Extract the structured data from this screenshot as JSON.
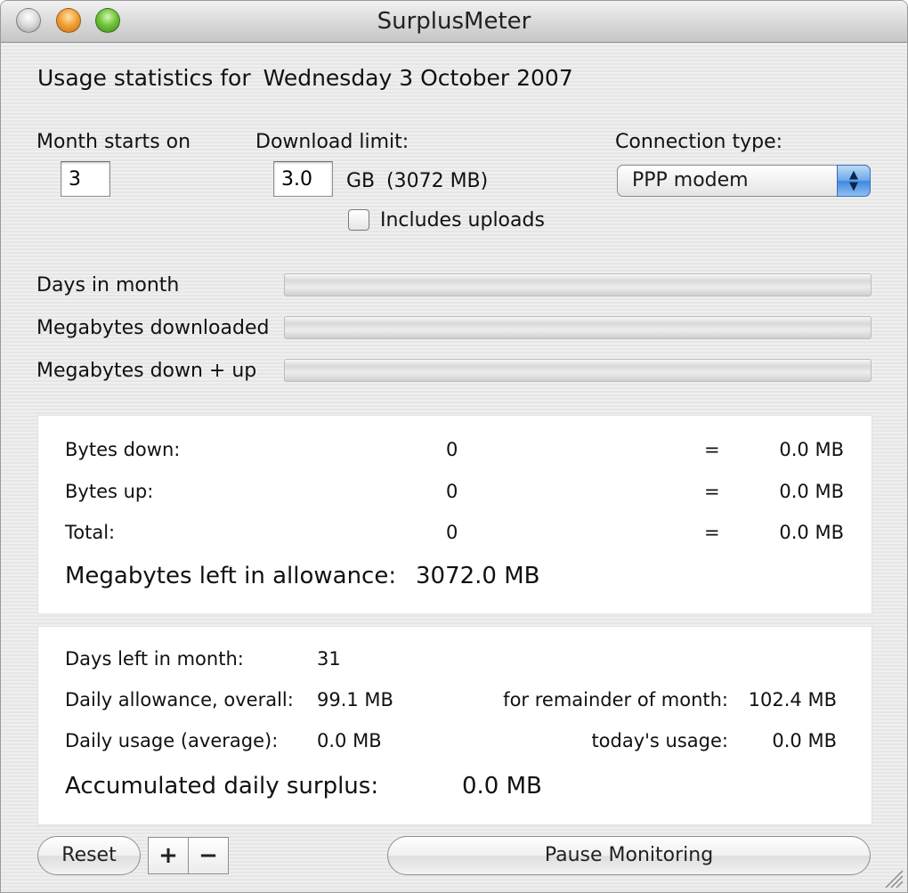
{
  "window": {
    "title": "SurplusMeter"
  },
  "header": {
    "usage_title": "Usage statistics for",
    "date": "Wednesday 3 October 2007"
  },
  "settings": {
    "month_starts_label": "Month starts on",
    "month_start_value": "3",
    "download_limit_label": "Download limit:",
    "download_limit_value": "3.0",
    "download_limit_unit": "GB",
    "download_limit_mb": "(3072 MB)",
    "includes_uploads_label": "Includes uploads",
    "includes_uploads_checked": false,
    "connection_type_label": "Connection type:",
    "connection_type_value": "PPP modem"
  },
  "meters": [
    {
      "label": "Days in month",
      "fraction": 0
    },
    {
      "label": "Megabytes downloaded",
      "fraction": 0
    },
    {
      "label": "Megabytes down + up",
      "fraction": 0
    }
  ],
  "bytes": {
    "rows": [
      {
        "label": "Bytes down:",
        "count": "0",
        "eq": "=",
        "mb": "0.0 MB"
      },
      {
        "label": "Bytes up:",
        "count": "0",
        "eq": "=",
        "mb": "0.0 MB"
      },
      {
        "label": "Total:",
        "count": "0",
        "eq": "=",
        "mb": "0.0 MB"
      }
    ],
    "left_label": "Megabytes left in allowance:",
    "left_value": "3072.0 MB"
  },
  "daily": {
    "days_left_label": "Days left in month:",
    "days_left_value": "31",
    "daily_overall_label": "Daily allowance, overall:",
    "daily_overall_value": "99.1 MB",
    "remainder_label": "for remainder of month:",
    "remainder_value": "102.4 MB",
    "daily_avg_label": "Daily usage (average):",
    "daily_avg_value": "0.0 MB",
    "today_label": "today's usage:",
    "today_value": "0.0 MB",
    "surplus_label": "Accumulated daily surplus:",
    "surplus_value": "0.0 MB"
  },
  "footer": {
    "reset_label": "Reset",
    "plus_label": "+",
    "minus_label": "−",
    "pause_label": "Pause Monitoring"
  },
  "icons": {
    "close": "close-icon",
    "minimize": "minimize-icon",
    "zoom": "zoom-icon",
    "popup_arrows": "popup-arrows-icon",
    "resize": "resize-grip-icon"
  }
}
